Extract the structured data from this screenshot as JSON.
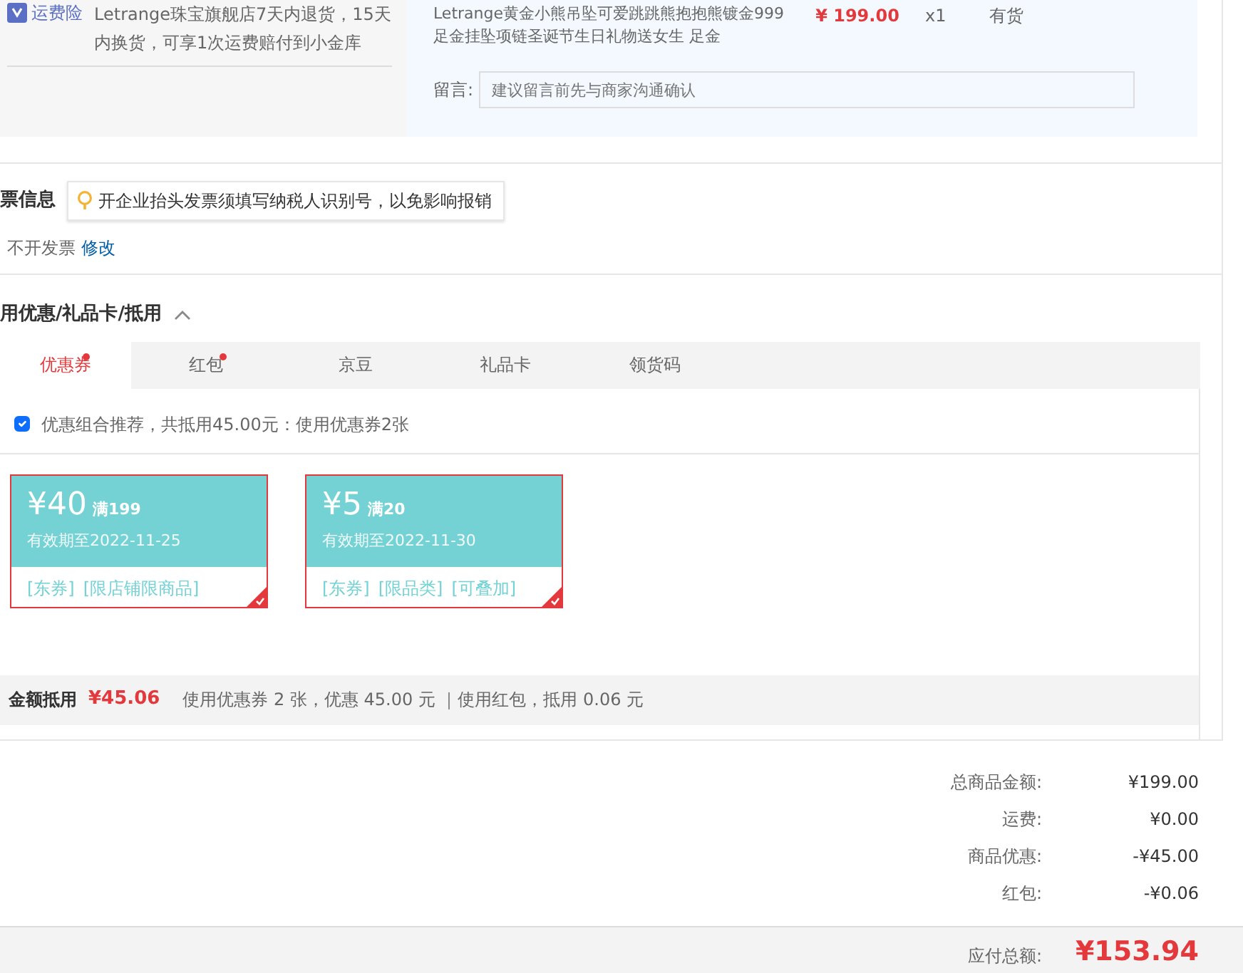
{
  "shipping_insurance": {
    "badge": "运费险",
    "text": "Letrange珠宝旗舰店7天内退货，15天内换货，可享1次运费赔付到小金库"
  },
  "product": {
    "title": "Letrange黄金小熊吊坠可爱跳跳熊抱抱熊镀金999足金挂坠项链圣诞节生日礼物送女生 足金",
    "price": "¥ 199.00",
    "quantity": "x1",
    "stock": "有货"
  },
  "message": {
    "label": "留言:",
    "placeholder": "建议留言前先与商家沟通确认"
  },
  "invoice": {
    "title": "票信息",
    "tip": "开企业抬头发票须填写纳税人识别号，以免影响报销",
    "value": "不开发票",
    "edit_link": "修改"
  },
  "discounts": {
    "title": "用优惠/礼品卡/抵用",
    "expanded": true,
    "tabs": [
      {
        "label": "优惠券",
        "selected": true,
        "dot": true
      },
      {
        "label": "红包",
        "selected": false,
        "dot": true
      },
      {
        "label": "京豆",
        "selected": false,
        "dot": false
      },
      {
        "label": "礼品卡",
        "selected": false,
        "dot": false
      },
      {
        "label": "领货码",
        "selected": false,
        "dot": false
      }
    ],
    "recommend": {
      "checked": true,
      "text": "优惠组合推荐，共抵用45.00元：使用优惠券2张"
    },
    "coupons": [
      {
        "amount": "¥40",
        "threshold": "满199",
        "expiry": "有效期至2022-11-25",
        "tags": [
          "[东券]",
          "[限店铺限商品]"
        ],
        "selected": true
      },
      {
        "amount": "¥5",
        "threshold": "满20",
        "expiry": "有效期至2022-11-30",
        "tags": [
          "[东券]",
          "[限品类]",
          "[可叠加]"
        ],
        "selected": true
      }
    ],
    "deduction": {
      "label": "金额抵用",
      "amount": "¥45.06",
      "detail": "使用优惠券 2 张，优惠 45.00 元 ｜使用红包，抵用 0.06 元"
    }
  },
  "summary": [
    {
      "label": "总商品金额:",
      "value": "¥199.00"
    },
    {
      "label": "运费:",
      "value": "¥0.00"
    },
    {
      "label": "商品优惠:",
      "value": "-¥45.00"
    },
    {
      "label": "红包:",
      "value": "-¥0.06"
    }
  ],
  "total": {
    "label": "应付总额:",
    "value": "¥153.94"
  }
}
